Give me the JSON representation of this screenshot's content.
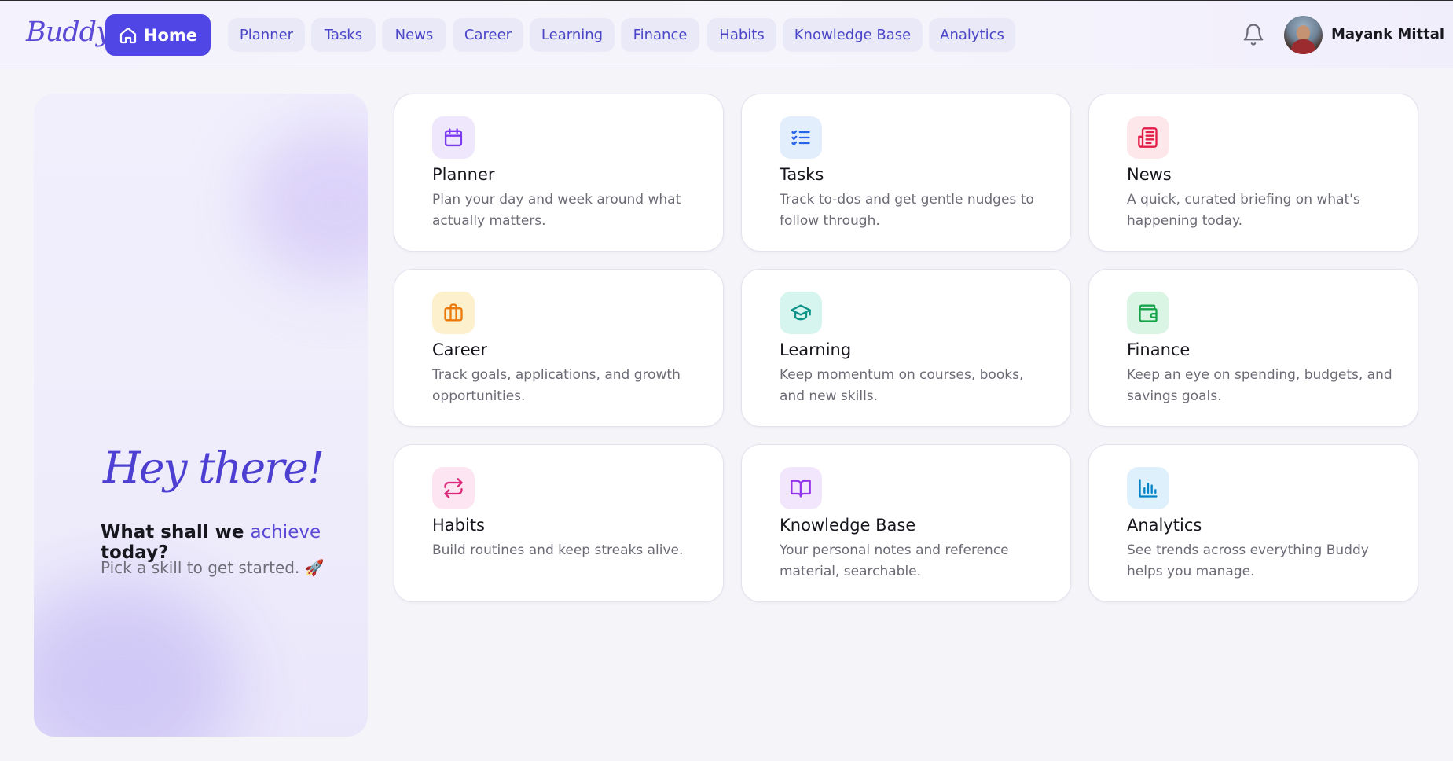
{
  "app": {
    "logo": "Buddy"
  },
  "nav": {
    "home_label": "Home",
    "items": [
      {
        "label": "Planner"
      },
      {
        "label": "Tasks"
      },
      {
        "label": "News"
      },
      {
        "label": "Career"
      },
      {
        "label": "Learning"
      },
      {
        "label": "Finance"
      },
      {
        "label": "Habits"
      },
      {
        "label": "Knowledge Base"
      },
      {
        "label": "Analytics"
      }
    ],
    "notifications_icon": "bell-icon",
    "user": {
      "name": "Mayank Mittal",
      "avatar": "avatar-photo"
    }
  },
  "hero": {
    "title": "Hey there!",
    "question_before": "What shall we ",
    "question_accent": "achieve",
    "question_after": " today?",
    "subtitle": "Pick a skill to get started. 🚀"
  },
  "colors": {
    "brand": "#4f46e5",
    "background": "#f4f4f9",
    "card": "#ffffff",
    "nav_pill": "#eae9f7"
  },
  "cards": [
    {
      "title": "Planner",
      "description": "Plan your day and week around what actually matters.",
      "icon": "calendar-icon",
      "icon_bg": "#efe8fd",
      "icon_color": "#7c3aed"
    },
    {
      "title": "Tasks",
      "description": "Track to-dos and get gentle nudges to follow through.",
      "icon": "checklist-icon",
      "icon_bg": "#e3eefd",
      "icon_color": "#2563eb"
    },
    {
      "title": "News",
      "description": "A quick, curated briefing on what's happening today.",
      "icon": "newspaper-icon",
      "icon_bg": "#fde7ea",
      "icon_color": "#e11d48"
    },
    {
      "title": "Career",
      "description": "Track goals, applications, and growth opportunities.",
      "icon": "briefcase-icon",
      "icon_bg": "#fdf1cd",
      "icon_color": "#ea7a0c"
    },
    {
      "title": "Learning",
      "description": "Keep momentum on courses, books, and new skills.",
      "icon": "graduation-cap-icon",
      "icon_bg": "#d6f5ef",
      "icon_color": "#0d9488"
    },
    {
      "title": "Finance",
      "description": "Keep an eye on spending, budgets, and savings goals.",
      "icon": "wallet-icon",
      "icon_bg": "#daf5e3",
      "icon_color": "#16a34a"
    },
    {
      "title": "Habits",
      "description": "Build routines and keep streaks alive.",
      "icon": "repeat-icon",
      "icon_bg": "#fde5f1",
      "icon_color": "#db2777"
    },
    {
      "title": "Knowledge Base",
      "description": "Your personal notes and reference material, searchable.",
      "icon": "book-open-icon",
      "icon_bg": "#f2e6fd",
      "icon_color": "#9333ea"
    },
    {
      "title": "Analytics",
      "description": "See trends across everything Buddy helps you manage.",
      "icon": "bar-chart-icon",
      "icon_bg": "#dff0fd",
      "icon_color": "#0284c7"
    }
  ]
}
